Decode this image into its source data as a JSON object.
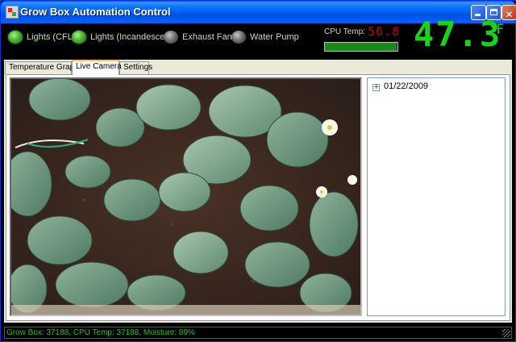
{
  "window": {
    "title": "Grow Box Automation Control"
  },
  "indicators": [
    {
      "label": "Lights (CFL)",
      "state": "on"
    },
    {
      "label": "Lights (Incandescent)",
      "state": "on"
    },
    {
      "label": "Exhaust Fan",
      "state": "off"
    },
    {
      "label": "Water Pump",
      "state": "off"
    }
  ],
  "cpu": {
    "label": "CPU Temp:",
    "value": "56.8",
    "level": 0.99
  },
  "temperature": {
    "value": "47.3",
    "unit": "°F"
  },
  "tabs": [
    {
      "label": "Temperature Graph",
      "active": false
    },
    {
      "label": "Live Camera",
      "active": true
    },
    {
      "label": "Settings",
      "active": false
    }
  ],
  "tree": {
    "expander": "+",
    "items": [
      "01/22/2009"
    ]
  },
  "status": {
    "text": "Grow Box: 37188, CPU Temp: 37188, Moisture: 89%"
  },
  "colors": {
    "led_on": "#4bb32a",
    "led_off": "#707070",
    "cpu_value": "#c80000",
    "temp_readout": "#18d418",
    "status_text": "#20c020"
  }
}
